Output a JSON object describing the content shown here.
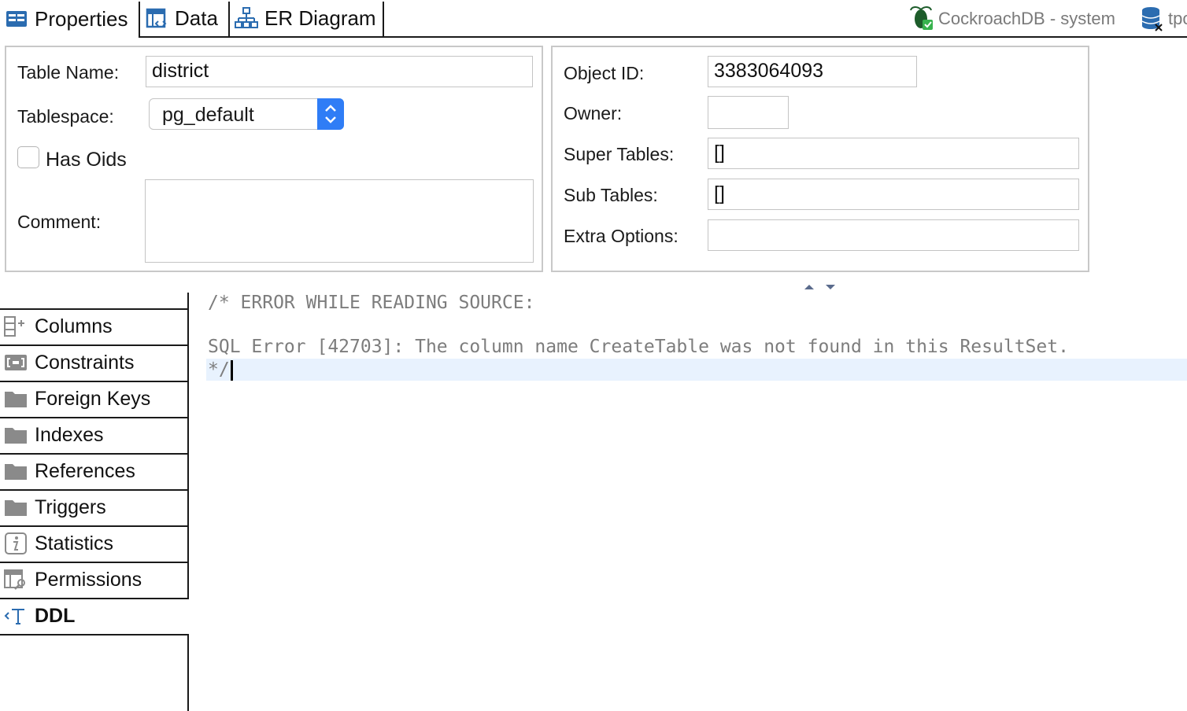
{
  "tabs": [
    {
      "label": "Properties",
      "icon": "properties-icon",
      "active": true
    },
    {
      "label": "Data",
      "icon": "data-grid-icon",
      "active": false
    },
    {
      "label": "ER Diagram",
      "icon": "er-diagram-icon",
      "active": false
    }
  ],
  "connection": {
    "label": "CockroachDB - system",
    "icon": "cockroachdb-icon",
    "database_label": "tpc",
    "database_icon": "database-icon"
  },
  "left_panel": {
    "table_name_label": "Table Name:",
    "table_name_value": "district",
    "tablespace_label": "Tablespace:",
    "tablespace_value": "pg_default",
    "has_oids_label": "Has Oids",
    "has_oids_checked": false,
    "comment_label": "Comment:",
    "comment_value": ""
  },
  "right_panel": {
    "object_id_label": "Object ID:",
    "object_id_value": "3383064093",
    "owner_label": "Owner:",
    "owner_value": "",
    "super_tables_label": "Super Tables:",
    "super_tables_value": "[]",
    "sub_tables_label": "Sub Tables:",
    "sub_tables_value": "[]",
    "extra_options_label": "Extra Options:",
    "extra_options_value": ""
  },
  "sidebar": {
    "items": [
      {
        "label": "Columns",
        "icon": "columns-icon"
      },
      {
        "label": "Constraints",
        "icon": "constraints-icon"
      },
      {
        "label": "Foreign Keys",
        "icon": "folder-icon"
      },
      {
        "label": "Indexes",
        "icon": "folder-icon"
      },
      {
        "label": "References",
        "icon": "folder-icon"
      },
      {
        "label": "Triggers",
        "icon": "folder-icon"
      },
      {
        "label": "Statistics",
        "icon": "info-icon"
      },
      {
        "label": "Permissions",
        "icon": "permissions-icon"
      },
      {
        "label": "DDL",
        "icon": "ddl-icon",
        "active": true
      }
    ]
  },
  "editor": {
    "lines": [
      "/* ERROR WHILE READING SOURCE:",
      "",
      "SQL Error [42703]: The column name CreateTable was not found in this ResultSet.",
      "*/"
    ]
  },
  "colors": {
    "accent": "#2f7df6",
    "icon_blue": "#2b6cb0",
    "current_line": "#e8f2fe"
  }
}
